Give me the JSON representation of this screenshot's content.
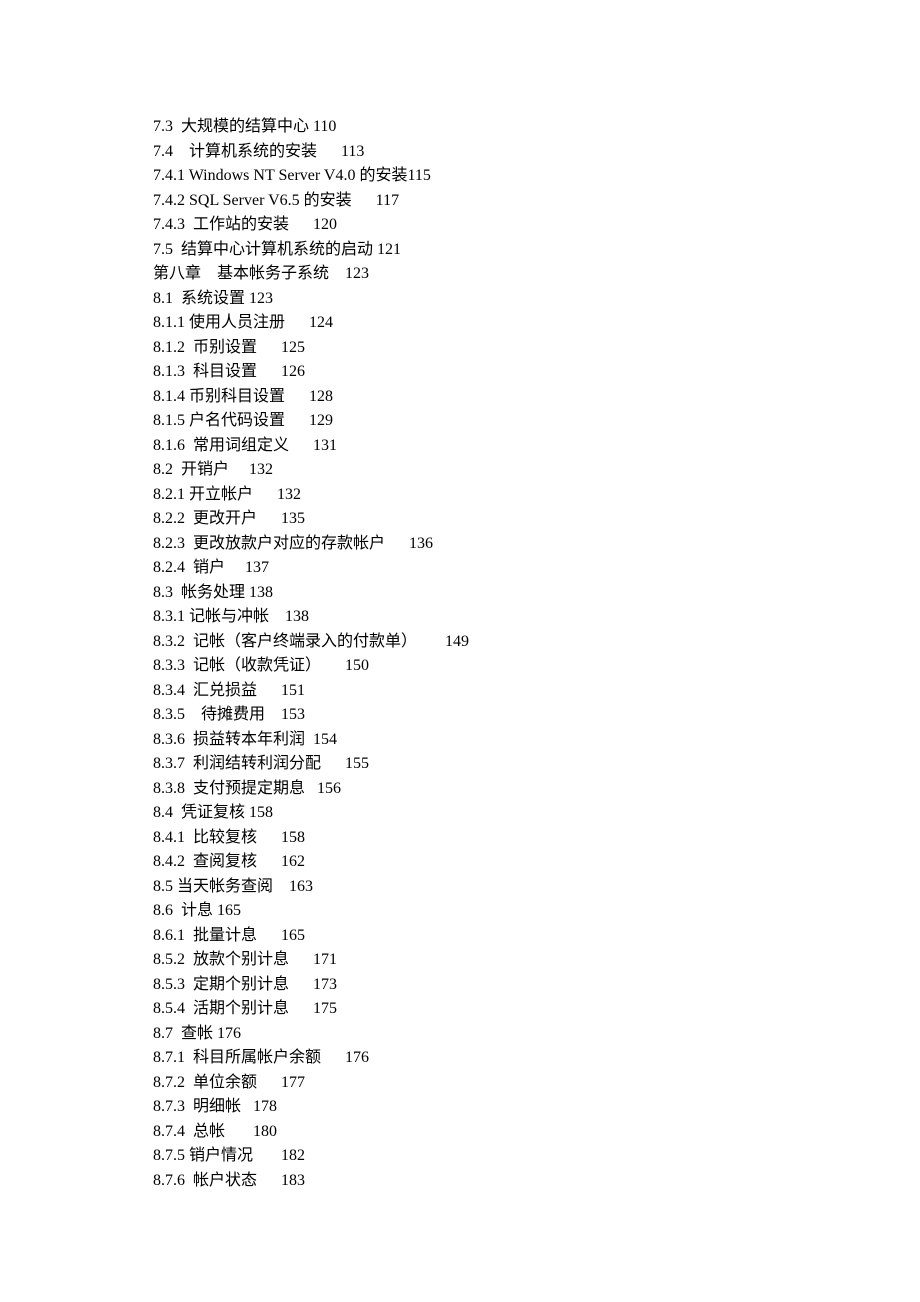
{
  "toc": [
    "7.3  大规模的结算中心 110",
    "7.4    计算机系统的安装      113",
    "7.4.1 Windows NT Server V4.0 的安装115",
    "7.4.2 SQL Server V6.5 的安装      117",
    "7.4.3  工作站的安装      120",
    "7.5  结算中心计算机系统的启动 121",
    "第八章    基本帐务子系统    123",
    "8.1  系统设置 123",
    "8.1.1 使用人员注册      124",
    "8.1.2  币别设置      125",
    "8.1.3  科目设置      126",
    "8.1.4 币别科目设置      128",
    "8.1.5 户名代码设置      129",
    "8.1.6  常用词组定义      131",
    "8.2  开销户     132",
    "8.2.1 开立帐户      132",
    "8.2.2  更改开户      135",
    "8.2.3  更改放款户对应的存款帐户      136",
    "8.2.4  销户     137",
    "8.3  帐务处理 138",
    "8.3.1 记帐与冲帐    138",
    "8.3.2  记帐（客户终端录入的付款单）       149",
    "8.3.3  记帐（收款凭证）      150",
    "8.3.4  汇兑损益      151",
    "8.3.5    待摊费用    153",
    "8.3.6  损益转本年利润  154",
    "8.3.7  利润结转利润分配      155",
    "8.3.8  支付预提定期息   156",
    "8.4  凭证复核 158",
    "8.4.1  比较复核      158",
    "8.4.2  查阅复核      162",
    "8.5 当天帐务查阅    163",
    "8.6  计息 165",
    "8.6.1  批量计息      165",
    "8.5.2  放款个别计息      171",
    "8.5.3  定期个别计息      173",
    "8.5.4  活期个别计息      175",
    "8.7  查帐 176",
    "8.7.1  科目所属帐户余额      176",
    "8.7.2  单位余额      177",
    "8.7.3  明细帐   178",
    "8.7.4  总帐       180",
    "8.7.5 销户情况       182",
    "8.7.6  帐户状态      183"
  ]
}
